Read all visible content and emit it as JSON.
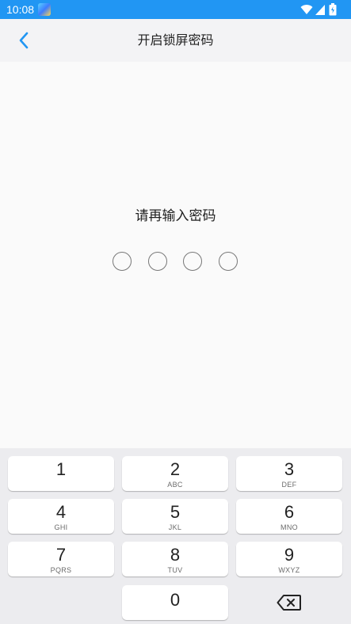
{
  "status_bar": {
    "time": "10:08",
    "background": "#2196f3",
    "icons": [
      "app-notification-icon",
      "wifi-icon",
      "signal-icon",
      "battery-icon"
    ]
  },
  "app_bar": {
    "title": "开启锁屏密码",
    "back_icon": "chevron-left-icon",
    "accent": "#2196f3"
  },
  "main": {
    "prompt": "请再输入密码",
    "pin_length": 4,
    "pin_filled": 0
  },
  "keypad": {
    "keys": [
      {
        "digit": "1",
        "letters": ""
      },
      {
        "digit": "2",
        "letters": "ABC"
      },
      {
        "digit": "3",
        "letters": "DEF"
      },
      {
        "digit": "4",
        "letters": "GHI"
      },
      {
        "digit": "5",
        "letters": "JKL"
      },
      {
        "digit": "6",
        "letters": "MNO"
      },
      {
        "digit": "7",
        "letters": "PQRS"
      },
      {
        "digit": "8",
        "letters": "TUV"
      },
      {
        "digit": "9",
        "letters": "WXYZ"
      },
      {
        "digit": "0",
        "letters": ""
      }
    ],
    "delete_icon": "backspace-icon"
  }
}
